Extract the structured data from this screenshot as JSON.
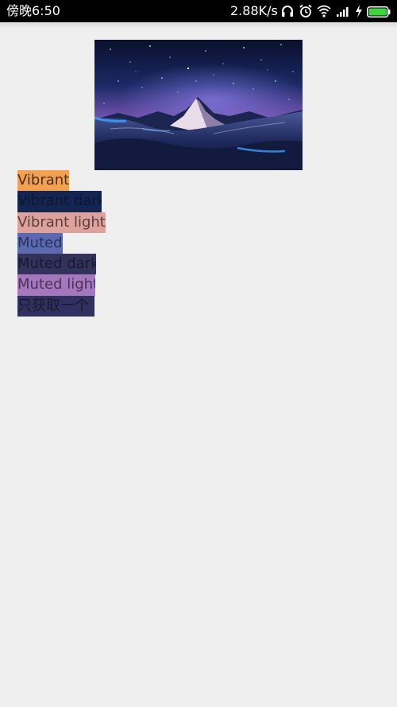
{
  "status_bar": {
    "time": "傍晚6:50",
    "network_speed": "2.88K/s",
    "icons": [
      "headphones-icon",
      "alarm-icon",
      "wifi-icon",
      "signal-icon",
      "charging-icon",
      "battery-icon"
    ]
  },
  "image": {
    "alt": "mountain-under-starry-sky"
  },
  "swatches": [
    {
      "label": "Vibrant",
      "color": "#f2a052"
    },
    {
      "label": "Vibrant dark",
      "color": "#142552"
    },
    {
      "label": "Vibrant light",
      "color": "#dea29d"
    },
    {
      "label": "Muted",
      "color": "#5b69b0"
    },
    {
      "label": "Muted dark",
      "color": "#33325a"
    },
    {
      "label": "Muted light",
      "color": "#a578bd"
    },
    {
      "label": "只获取一个",
      "color": "#313060"
    }
  ]
}
